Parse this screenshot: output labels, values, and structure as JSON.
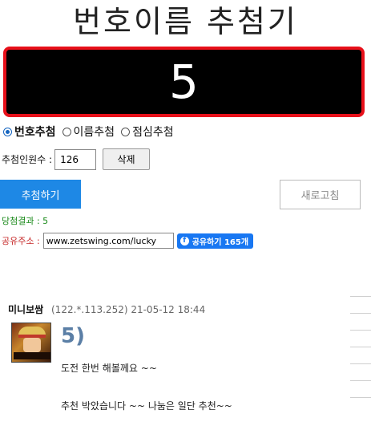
{
  "title": "번호이름 추첨기",
  "display_number": "5",
  "modes": [
    {
      "label": "번호추첨",
      "selected": true
    },
    {
      "label": "이름추첨",
      "selected": false
    },
    {
      "label": "점심추첨",
      "selected": false
    }
  ],
  "count": {
    "label": "추첨인원수 :",
    "value": "126",
    "delete_label": "삭제"
  },
  "buttons": {
    "draw": "추첨하기",
    "refresh": "새로고침"
  },
  "result_text": "당첨결과 : 5",
  "share": {
    "label": "공유주소 :",
    "url": "www.zetswing.com/lucky",
    "fb_label": "공유하기 165개"
  },
  "comment": {
    "author": "미니보쌈",
    "meta": "(122.*.113.252) 21-05-12 18:44",
    "number": "5)",
    "line1": "도전 한번 해볼께요 ~~",
    "line2": "추천 박았습니다 ~~ 나눔은 일단 추천~~"
  },
  "colors": {
    "accent": "#1e88e5",
    "display_border": "#e8101a",
    "result": "#1a8a1a",
    "share_label": "#c62828",
    "facebook": "#1877f2"
  }
}
